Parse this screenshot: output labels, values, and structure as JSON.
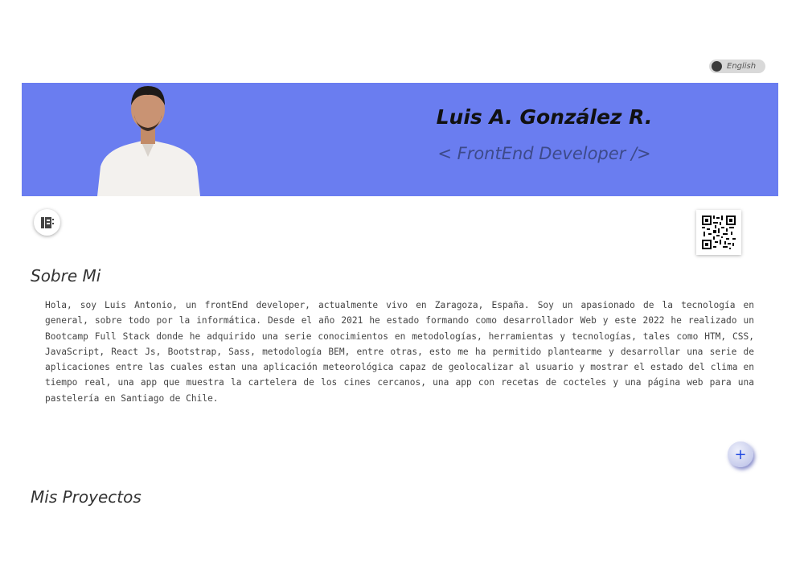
{
  "language_toggle": {
    "label": "English"
  },
  "header": {
    "name": "Luis A. González R.",
    "role": "< FrontEnd Developer />"
  },
  "about": {
    "title": "Sobre Mi",
    "text": "Hola, soy Luis Antonio, un frontEnd developer, actualmente vivo en Zaragoza, España. Soy un apasionado de la tecnología en general, sobre todo por la informática. Desde el año 2021 he estado formando como desarrollador Web y este 2022 he realizado un Bootcamp Full Stack donde he adquirido una serie conocimientos en metodologías, herramientas y tecnologías, tales como HTM, CSS, JavaScript, React Js, Bootstrap, Sass, metodología BEM, entre otras, esto me ha permitido plantearme y desarrollar una serie de aplicaciones entre las cuales estan una aplicación meteorológica capaz de geolocalizar al usuario y mostrar el estado del clima en tiempo real, una app que muestra la cartelera de los cines cercanos, una app con recetas de cocteles y una página web para una pastelería en Santiago de Chile."
  },
  "more_button": {
    "label": "+"
  },
  "projects": {
    "title": "Mis Proyectos"
  },
  "icons": {
    "cv": "cv-document-icon",
    "qr": "qr-code-icon",
    "more": "plus-icon"
  },
  "colors": {
    "banner": "#6a7df0",
    "name": "#111111",
    "role": "#3d4a8a",
    "more_icon": "#1f47e0"
  }
}
